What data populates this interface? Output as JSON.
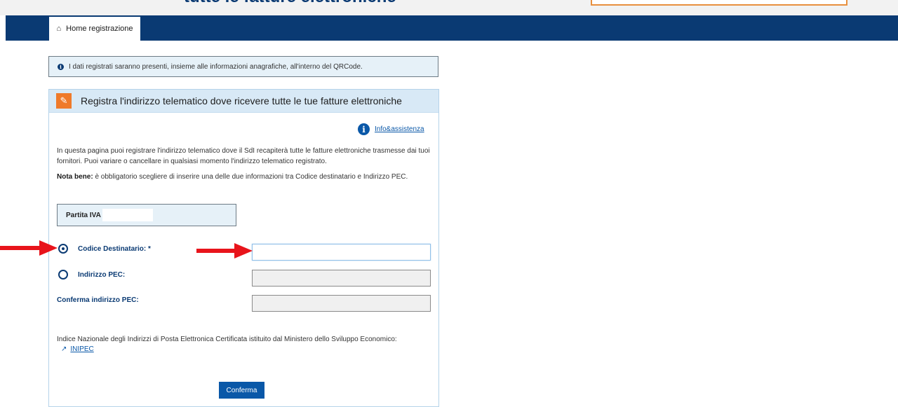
{
  "header": {
    "cut_title": "tutte le fatture elettroniche"
  },
  "nav": {
    "home_tab_label": "Home registrazione",
    "home_icon": "home-icon"
  },
  "info_bar": {
    "text": "I dati registrati saranno presenti, insieme alle informazioni anagrafiche, all'interno del QRCode.",
    "icon": "info-icon"
  },
  "panel": {
    "title": "Registra l'indirizzo telematico dove ricevere tutte le tue fatture elettroniche",
    "icon": "pencil-icon",
    "help_link": "Info&assistenza",
    "description": "In questa pagina puoi registrare l'indirizzo telematico dove il SdI recapiterà tutte le fatture elettroniche trasmesse dai tuoi fornitori. Puoi variare o cancellare in qualsiasi momento l'indirizzo telematico registrato.",
    "nota_label": "Nota bene:",
    "nota_text": " è obbligatorio scegliere di inserire una delle due informazioni tra Codice destinatario e Indirizzo PEC.",
    "piva_label": "Partita IVA"
  },
  "form": {
    "codice_label": "Codice Destinatario: *",
    "codice_value": "",
    "pec_label": "Indirizzo PEC:",
    "pec_value": "",
    "conferma_pec_label": "Conferma indirizzo PEC:",
    "conferma_pec_value": "",
    "selected": "codice_destinatario"
  },
  "inipec": {
    "text": "Indice Nazionale degli Indirizzi di Posta Elettronica Certificata istituito dal Ministero dello Sviluppo Economico:",
    "link_label": "INIPEC",
    "icon": "external-link-icon"
  },
  "actions": {
    "confirm_label": "Conferma"
  },
  "colors": {
    "navy": "#0a3a73",
    "link_blue": "#0a58a8",
    "accent_orange": "#ef7a2a",
    "arrow_red": "#e8141b"
  }
}
